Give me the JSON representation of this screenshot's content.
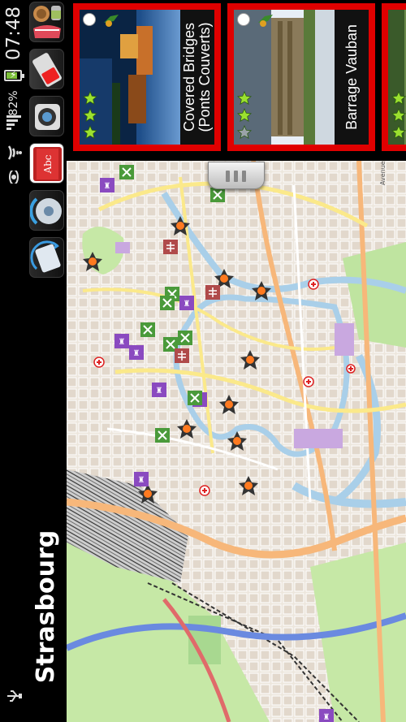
{
  "status_bar": {
    "time": "07:48",
    "battery_percent": "82%",
    "battery_level": 0.82,
    "icons": [
      "signal-icon",
      "wifi-icon",
      "eye-icon",
      "usb-icon",
      "battery-charging-icon"
    ]
  },
  "app_shortcuts": [
    "food-app-icon",
    "battery-app-icon",
    "camera-app-icon",
    "dictionary-app-icon",
    "media-app-icon",
    "rotate-app-icon"
  ],
  "app": {
    "title": "Strasbourg"
  },
  "attractions": [
    {
      "name": "Covered Bridges (Ponts Couverts)",
      "rating": 3,
      "max_rating": 3
    },
    {
      "name": "Barrage Vauban",
      "rating": 2,
      "max_rating": 3
    },
    {
      "name": "",
      "rating": 3,
      "max_rating": 3
    }
  ],
  "map": {
    "street_label": "Avenue de la Paix",
    "colors": {
      "water": "#a9cfe9",
      "major_road": "#f7b77a",
      "secondary_road": "#fbe98a",
      "park": "#c6e8a6",
      "rail": "#333333"
    },
    "markers": {
      "star_sight": "star-orange-marker-icon",
      "hospital": "hospital-cross-icon",
      "museum": "museum-purple-icon",
      "restaurant": "restaurant-green-icon",
      "shop": "shop-red-icon"
    }
  },
  "theme": {
    "card_border": "#e00000",
    "star_green": "#9be02f"
  }
}
